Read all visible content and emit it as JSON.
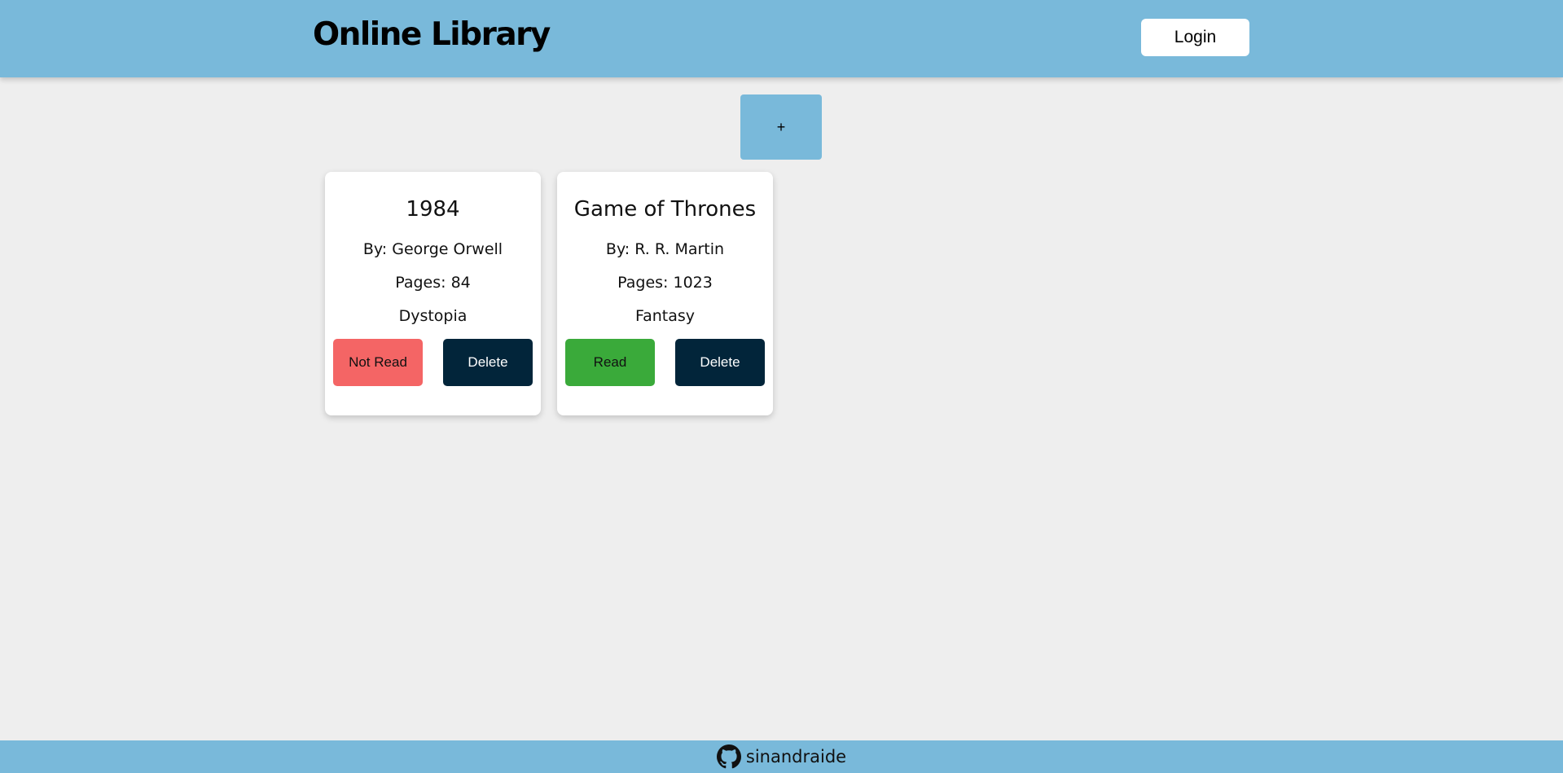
{
  "header": {
    "title": "Online Library",
    "login_label": "Login"
  },
  "toolbar": {
    "add_label": "+"
  },
  "books": [
    {
      "title": "1984",
      "author": "By: George Orwell",
      "pages": "Pages: 84",
      "genre": "Dystopia",
      "status_label": "Not Read",
      "status_color": "#f46565",
      "delete_label": "Delete"
    },
    {
      "title": "Game of Thrones",
      "author": "By: R. R. Martin",
      "pages": "Pages: 1023",
      "genre": "Fantasy",
      "status_label": "Read",
      "status_color": "#3aaa3a",
      "delete_label": "Delete"
    }
  ],
  "footer": {
    "icon": "github-icon",
    "label": "sinandraide"
  },
  "colors": {
    "accent": "#79b9da",
    "background": "#eeeeee",
    "delete": "#02253a"
  }
}
